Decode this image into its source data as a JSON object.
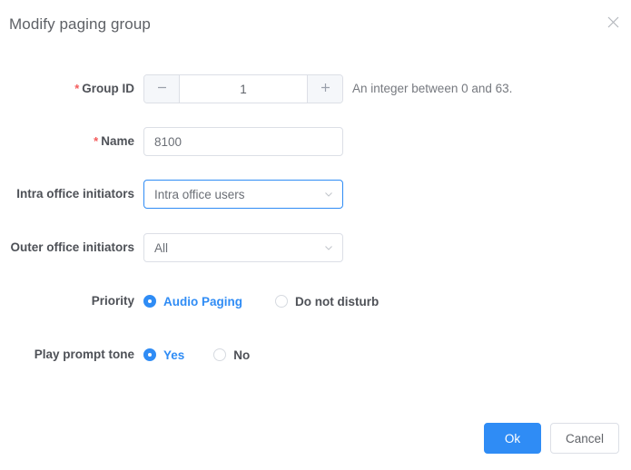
{
  "dialog": {
    "title": "Modify paging group",
    "close_icon": "close-icon"
  },
  "form": {
    "group_id": {
      "label": "Group ID",
      "required_mark": "*",
      "value": "1",
      "minus_icon": "minus-icon",
      "plus_icon": "plus-icon",
      "helper": "An integer between 0 and 63."
    },
    "name": {
      "label": "Name",
      "required_mark": "*",
      "value": "8100",
      "placeholder": ""
    },
    "intra_office_initiators": {
      "label": "Intra office initiators",
      "value": "Intra office users",
      "caret_icon": "chevron-down-icon"
    },
    "outer_office_initiators": {
      "label": "Outer office initiators",
      "value": "All",
      "caret_icon": "chevron-down-icon"
    },
    "priority": {
      "label": "Priority",
      "options": [
        {
          "label": "Audio Paging",
          "selected": true
        },
        {
          "label": "Do not disturb",
          "selected": false
        }
      ]
    },
    "play_prompt_tone": {
      "label": "Play prompt tone",
      "options": [
        {
          "label": "Yes",
          "selected": true
        },
        {
          "label": "No",
          "selected": false
        }
      ]
    }
  },
  "footer": {
    "ok_label": "Ok",
    "cancel_label": "Cancel"
  },
  "colors": {
    "accent": "#2f8cf5",
    "required_star": "#f45b5b",
    "label_text": "#4e5157",
    "border": "#dcdfe6"
  }
}
